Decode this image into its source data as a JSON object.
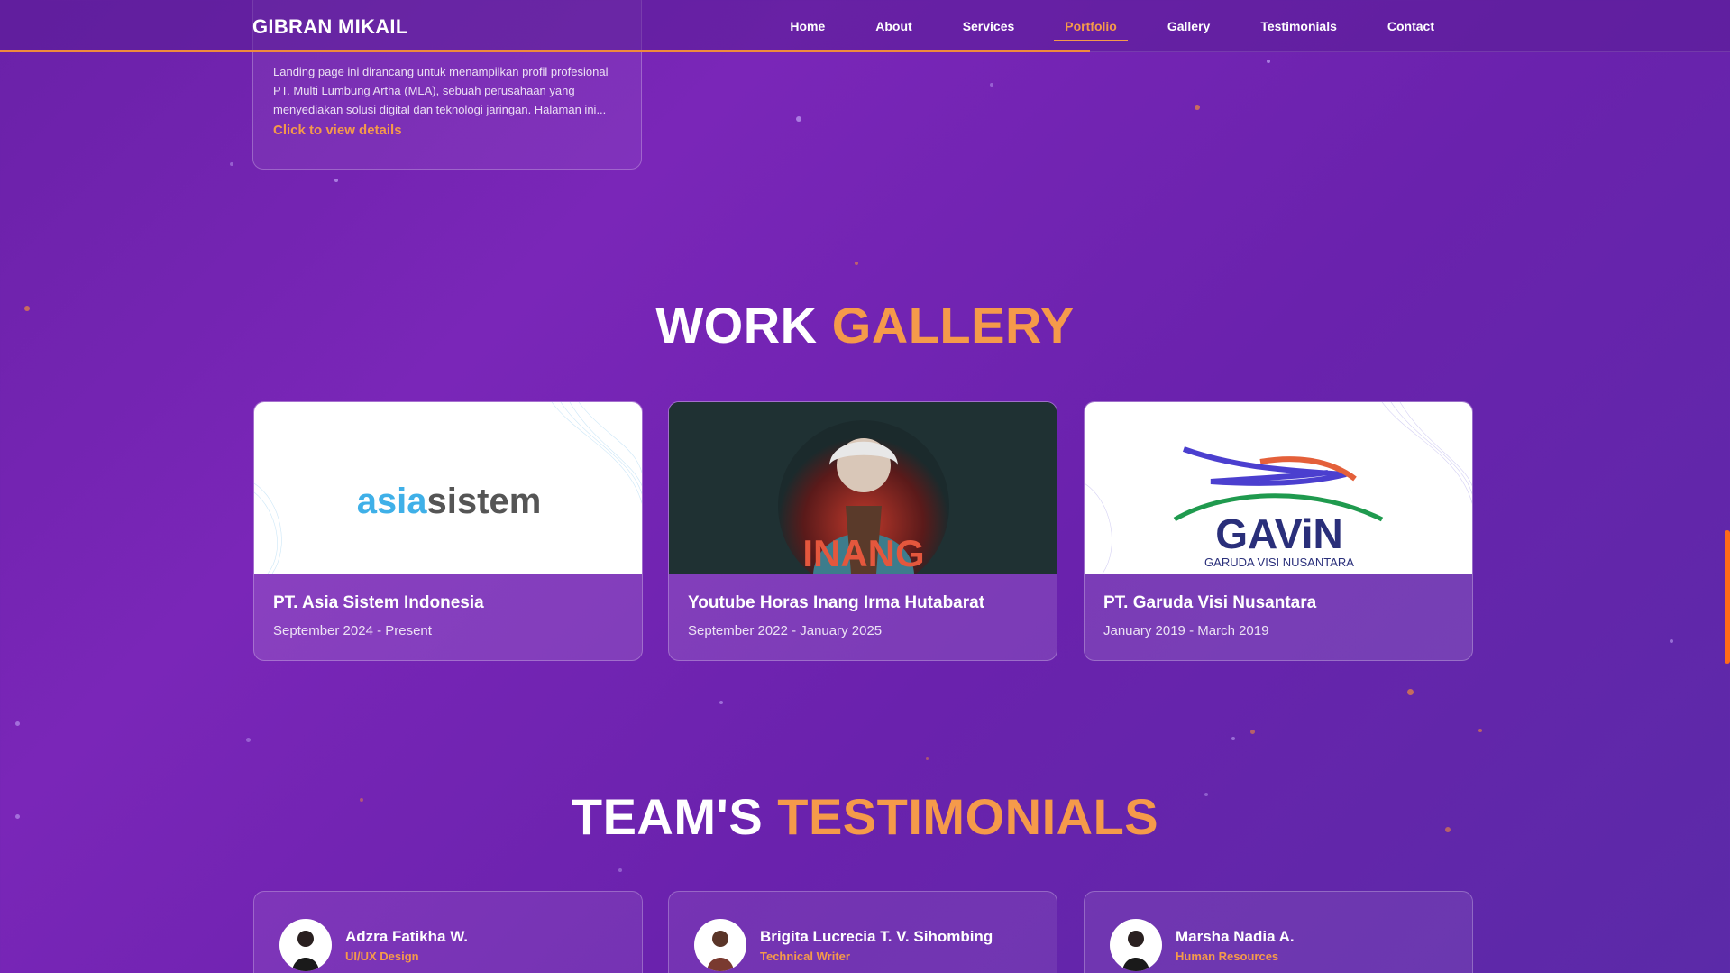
{
  "nav": {
    "brand": "GIBRAN MIKAIL",
    "links": [
      "Home",
      "About",
      "Services",
      "Portfolio",
      "Gallery",
      "Testimonials",
      "Contact"
    ],
    "active": "Portfolio"
  },
  "previous_card": {
    "description": "Landing page ini dirancang untuk menampilkan profil profesional PT. Multi Lumbung Artha (MLA), sebuah perusahaan yang menyediakan solusi digital dan teknologi jaringan. Halaman ini...",
    "link": "Click to view details"
  },
  "gallery": {
    "title_main": "WORK",
    "title_accent": "GALLERY",
    "items": [
      {
        "title": "PT. Asia Sistem Indonesia",
        "date": "September 2024 - Present",
        "logo_a": "asia",
        "logo_b": "sistem"
      },
      {
        "title": "Youtube Horas Inang Irma Hutabarat",
        "date": "September 2022 - January 2025",
        "logo_a": "INANG",
        "logo_b": ""
      },
      {
        "title": "PT. Garuda Visi Nusantara",
        "date": "January 2019 - March 2019",
        "logo_a": "GAViN",
        "logo_b": "GARUDA VISI NUSANTARA"
      }
    ]
  },
  "testimonials": {
    "title_main": "TEAM'S",
    "title_accent": "TESTIMONIALS",
    "items": [
      {
        "name": "Adzra Fatikha W.",
        "role": "UI/UX Design"
      },
      {
        "name": "Brigita Lucrecia T. V. Sihombing",
        "role": "Technical Writer"
      },
      {
        "name": "Marsha Nadia A.",
        "role": "Human Resources"
      }
    ]
  },
  "colors": {
    "accent": "#f59a4a",
    "background": "#6a21a8",
    "scroll_thumb": "#ff6a1a"
  },
  "scroll_progress_fraction": 0.63
}
